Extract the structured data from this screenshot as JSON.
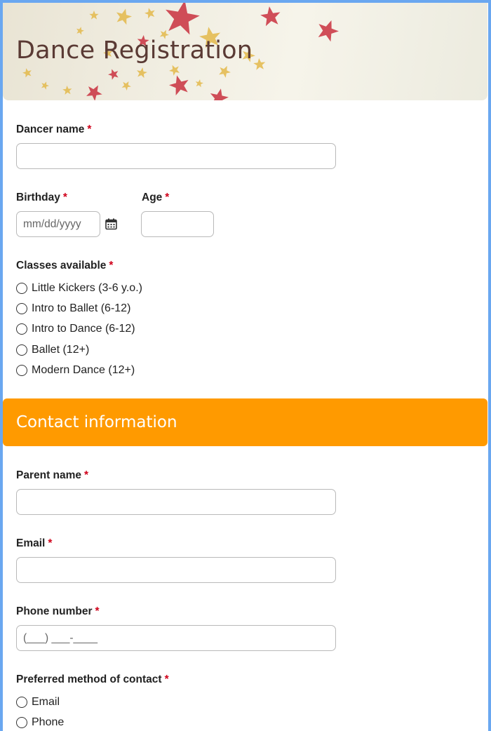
{
  "header": {
    "title": "Dance Registration"
  },
  "required_mark": "*",
  "dancer_name": {
    "label": "Dancer name",
    "value": ""
  },
  "birthday": {
    "label": "Birthday",
    "placeholder": "mm/dd/yyyy"
  },
  "age": {
    "label": "Age",
    "value": ""
  },
  "classes": {
    "label": "Classes available",
    "options": [
      "Little Kickers (3-6 y.o.)",
      "Intro to Ballet (6-12)",
      "Intro to Dance (6-12)",
      "Ballet (12+)",
      "Modern Dance (12+)"
    ]
  },
  "contact_section": {
    "title": "Contact information"
  },
  "parent_name": {
    "label": "Parent name",
    "value": ""
  },
  "email": {
    "label": "Email",
    "value": ""
  },
  "phone": {
    "label": "Phone number",
    "mask": "(___) ___-____"
  },
  "contact_method": {
    "label": "Preferred method of contact",
    "options": [
      "Email",
      "Phone"
    ]
  },
  "colors": {
    "frame": "#6aa7f0",
    "section_bar": "#ff9a00",
    "required": "#d0021b",
    "title_text": "#5a3a34"
  },
  "icons": {
    "birthday_picker": "calendar-icon"
  }
}
